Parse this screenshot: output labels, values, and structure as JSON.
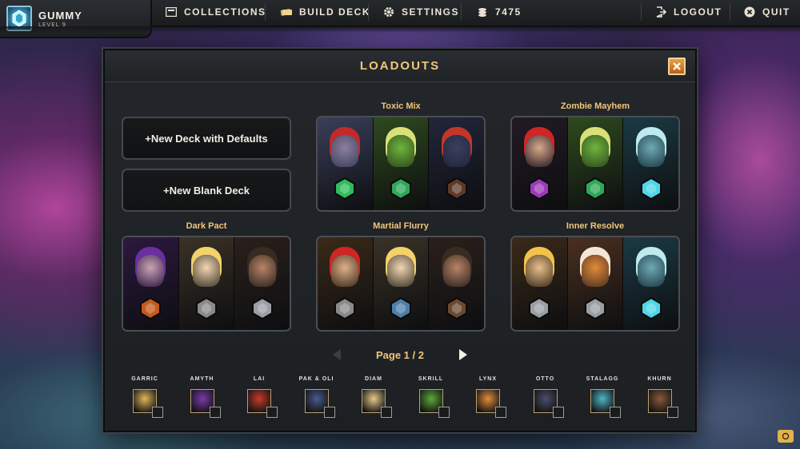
{
  "player": {
    "name": "GUMMY",
    "level": "LEVEL 9"
  },
  "nav": {
    "collections": "COLLECTIONS",
    "build_deck": "BUILD DECK",
    "settings": "SETTINGS",
    "gold": "7475",
    "logout": "LOGOUT",
    "quit": "QUIT"
  },
  "modal": {
    "title": "LOADOUTS",
    "new_default_label": "+New Deck with Defaults",
    "new_blank_label": "+New Blank Deck",
    "page_label": "Page 1 / 2"
  },
  "decks": [
    {
      "name": "Toxic Mix",
      "slots": [
        {
          "bg": "#3a3f5a",
          "face": "#8d7fa0",
          "gem": "#2ebd5a",
          "accent": "#c22a2a"
        },
        {
          "bg": "#2e4a1e",
          "face": "#6fb43c",
          "gem": "#2ea85a",
          "accent": "#d9e07a"
        },
        {
          "bg": "#22263a",
          "face": "#3a3f5e",
          "gem": "#5e3a28",
          "accent": "#c2372a"
        }
      ]
    },
    {
      "name": "Zombie Mayhem",
      "slots": [
        {
          "bg": "#221a24",
          "face": "#d9a98c",
          "gem": "#9d3ab8",
          "accent": "#d02525"
        },
        {
          "bg": "#2e4a1e",
          "face": "#6fb43c",
          "gem": "#2ea85a",
          "accent": "#d9e07a"
        },
        {
          "bg": "#1b3a44",
          "face": "#6fa9b3",
          "gem": "#4fd6e6",
          "accent": "#bde9ef"
        }
      ]
    },
    {
      "name": "Dark Pact",
      "slots": [
        {
          "bg": "#2c1840",
          "face": "#caa3b5",
          "gem": "#c25a1e",
          "accent": "#6a2fa0"
        },
        {
          "bg": "#3a3227",
          "face": "#f1d7b3",
          "gem": "#8a8a8a",
          "accent": "#f2d26a"
        },
        {
          "bg": "#2a201c",
          "face": "#b88466",
          "gem": "#9a9ea5",
          "accent": "#3a2a20"
        }
      ]
    },
    {
      "name": "Martial Flurry",
      "slots": [
        {
          "bg": "#3a2a18",
          "face": "#e0b08c",
          "gem": "#8a8a8a",
          "accent": "#d02525"
        },
        {
          "bg": "#3a3227",
          "face": "#f1d7b3",
          "gem": "#4f7fa8",
          "accent": "#f2d26a"
        },
        {
          "bg": "#2a201c",
          "face": "#b88466",
          "gem": "#6a4a32",
          "accent": "#3a2a20"
        }
      ]
    },
    {
      "name": "Inner Resolve",
      "slots": [
        {
          "bg": "#3a2a18",
          "face": "#e8c08c",
          "gem": "#9a9ea5",
          "accent": "#f2c24a"
        },
        {
          "bg": "#4a3020",
          "face": "#e38a3a",
          "gem": "#9a9ea5",
          "accent": "#f4e6d6"
        },
        {
          "bg": "#1b3a44",
          "face": "#6fa9b3",
          "gem": "#4fd6e6",
          "accent": "#bde9ef"
        }
      ]
    }
  ],
  "heroes": [
    {
      "name": "GARRIC",
      "color": "#e3b55a"
    },
    {
      "name": "AMYTH",
      "color": "#7a3aa8"
    },
    {
      "name": "LAI",
      "color": "#c83a2a"
    },
    {
      "name": "PAK & OLI",
      "color": "#4a5a8a"
    },
    {
      "name": "DIAM",
      "color": "#e8c88c"
    },
    {
      "name": "SKRILL",
      "color": "#5fa83a"
    },
    {
      "name": "LYNX",
      "color": "#e38a3a"
    },
    {
      "name": "OTTO",
      "color": "#4a4f6a"
    },
    {
      "name": "STALAGG",
      "color": "#4fb6c6"
    },
    {
      "name": "KHURN",
      "color": "#8a5a3a"
    }
  ]
}
